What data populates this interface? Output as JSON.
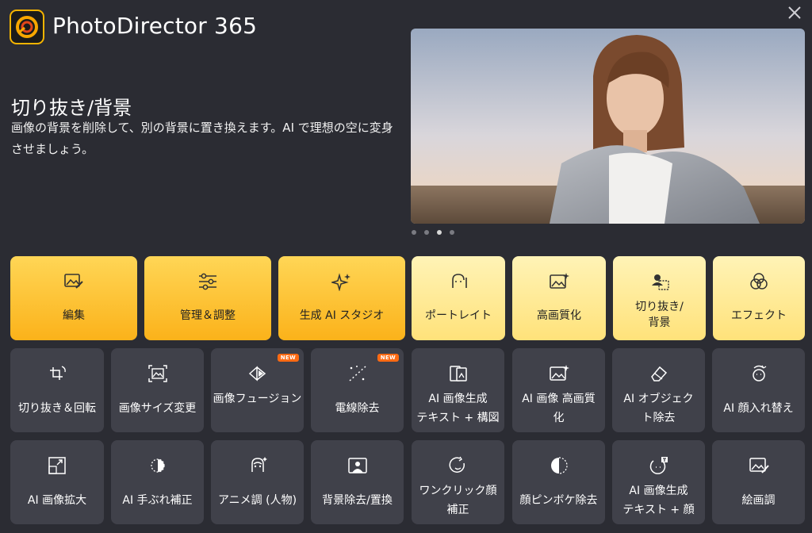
{
  "app": {
    "title": "PhotoDirector 365"
  },
  "feature": {
    "title": "切り抜き/背景",
    "description": "画像の背景を削除して、別の背景に置き換えます。AI で理想の空に変身させましょう。"
  },
  "carousel": {
    "count": 4,
    "active_index": 2
  },
  "top_tiles": [
    {
      "label": "編集",
      "icon": "image-edit-icon",
      "style": "yellow"
    },
    {
      "label": "管理＆調整",
      "icon": "sliders-icon",
      "style": "yellow"
    },
    {
      "label": "生成 AI スタジオ",
      "icon": "sparkles-icon",
      "style": "yellow"
    },
    {
      "label": "ポートレイト",
      "icon": "face-icon",
      "style": "light"
    },
    {
      "label": "高画質化",
      "icon": "image-sparkle-icon",
      "style": "light"
    },
    {
      "label": "切り抜き/\n背景",
      "icon": "cutout-icon",
      "style": "light"
    },
    {
      "label": "エフェクト",
      "icon": "circles-icon",
      "style": "light"
    }
  ],
  "row2": [
    {
      "label": "切り抜き＆回転",
      "icon": "crop-rotate-icon"
    },
    {
      "label": "画像サイズ変更",
      "icon": "resize-icon"
    },
    {
      "label": "画像フュージョン",
      "icon": "fusion-icon",
      "badge": "NEW"
    },
    {
      "label": "電線除去",
      "icon": "wire-removal-icon",
      "badge": "NEW"
    },
    {
      "label": "AI 画像生成\nテキスト + 構図",
      "icon": "layout-image-icon"
    },
    {
      "label": "AI 画像 高画質\n化",
      "icon": "image-sparkle-icon"
    },
    {
      "label": "AI オブジェク\nト除去",
      "icon": "eraser-icon"
    },
    {
      "label": "AI 顔入れ替え",
      "icon": "face-swap-icon"
    }
  ],
  "row3": [
    {
      "label": "AI 画像拡大",
      "icon": "expand-icon"
    },
    {
      "label": "AI 手ぶれ補正",
      "icon": "deblur-icon"
    },
    {
      "label": "アニメ調 (人物)",
      "icon": "anime-face-icon"
    },
    {
      "label": "背景除去/置換",
      "icon": "background-icon"
    },
    {
      "label": "ワンクリック顔\n補正",
      "icon": "face-retouch-icon"
    },
    {
      "label": "顔ピンボケ除去",
      "icon": "face-deblur-icon"
    },
    {
      "label": "AI 画像生成\nテキスト + 顔",
      "icon": "text-face-icon"
    },
    {
      "label": "絵画調",
      "icon": "painting-icon"
    }
  ],
  "colors": {
    "background": "#2b2c33",
    "tile_grey": "#40414a",
    "tile_yellow": "#fbb21a",
    "tile_light_yellow": "#ffe27a",
    "badge": "#ff6a13"
  }
}
